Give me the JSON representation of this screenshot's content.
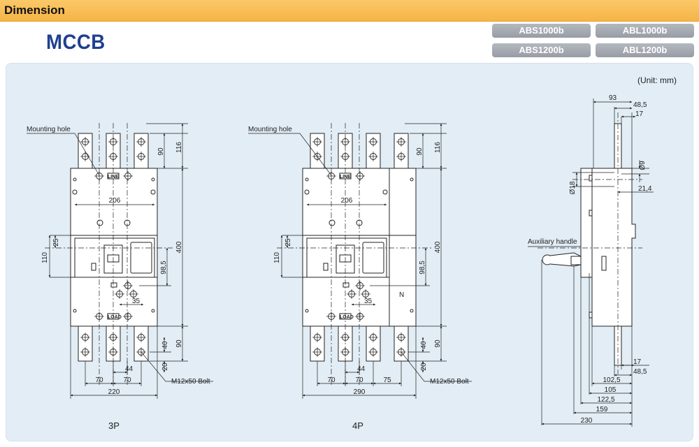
{
  "header": {
    "title": "Dimension"
  },
  "product": {
    "name": "MCCB"
  },
  "models": [
    "ABS1000b",
    "ABL1000b",
    "ABS1200b",
    "ABL1200b"
  ],
  "unit_label": "(Unit: mm)",
  "view_3p": {
    "label": "3P",
    "mounting_hole_label": "Mounting hole",
    "bolt_label": "M12x50  Bolt",
    "line_label": "LINE",
    "load_label": "LOAD",
    "dims": {
      "d116": "116",
      "d90_top": "90",
      "d206": "206",
      "d400": "400",
      "d25": "25",
      "d110": "110",
      "d98_5": "98,5",
      "d35": "35",
      "d40": "40",
      "d90_bot": "90",
      "d20": "20",
      "d44": "44",
      "d70a": "70",
      "d70b": "70",
      "d220": "220"
    }
  },
  "view_4p": {
    "label": "4P",
    "mounting_hole_label": "Mounting hole",
    "bolt_label": "M12x50  Bolt",
    "line_label": "LINE",
    "load_label": "LOAD",
    "neutral_label": "N",
    "dims": {
      "d116": "116",
      "d90_top": "90",
      "d206": "206",
      "d400": "400",
      "d25": "25",
      "d110": "110",
      "d98_5": "98,5",
      "d35": "35",
      "d40": "40",
      "d90_bot": "90",
      "d20": "20",
      "d44": "44",
      "d70a": "70",
      "d70b": "70",
      "d75": "75",
      "d290": "290"
    }
  },
  "side_view": {
    "aux_handle_label": "Auxiliary handle",
    "dims": {
      "d93": "93",
      "d48_5_top": "48,5",
      "d17_top": "17",
      "d9": "Ø9",
      "d18": "Ø18",
      "d21_4": "21,4",
      "d17_bot": "17",
      "d48_5_bot": "48,5",
      "d102_5": "102,5",
      "d105": "105",
      "d122_5": "122,5",
      "d159": "159",
      "d230": "230"
    }
  }
}
